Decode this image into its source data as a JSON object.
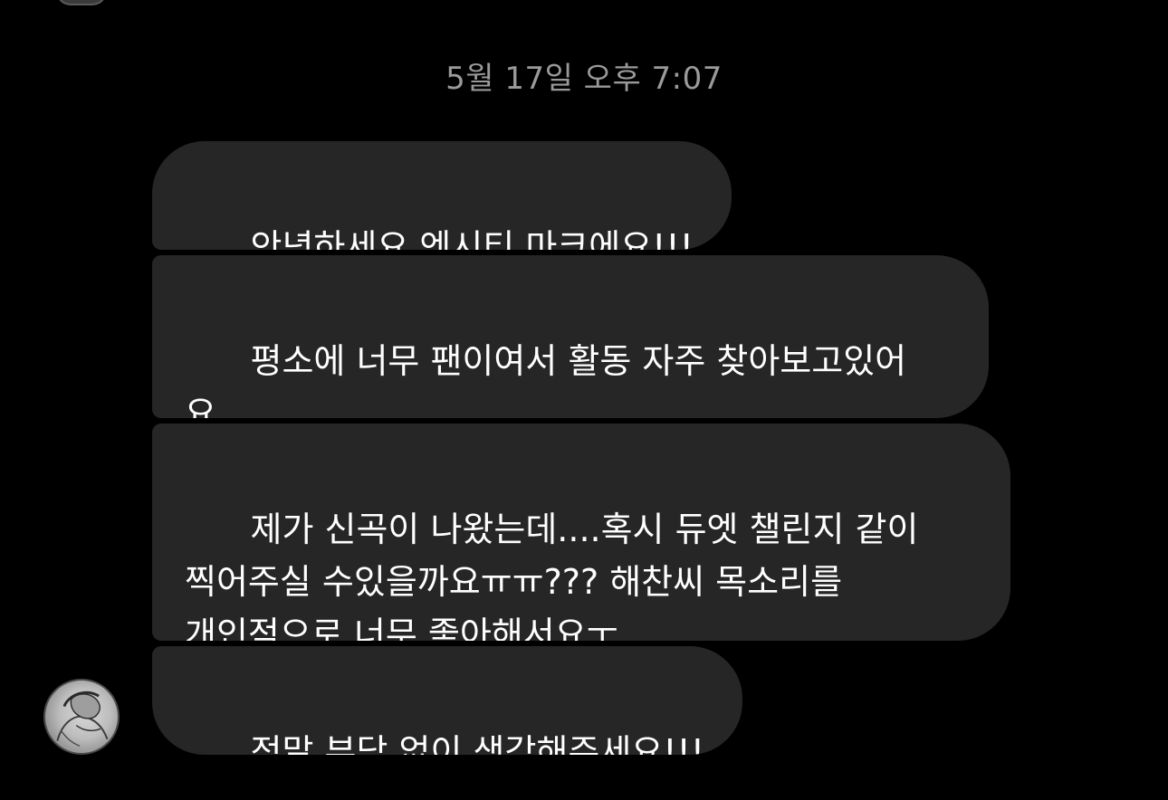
{
  "thread": {
    "timestamp": "5월 17일 오후 7:07",
    "messages": [
      {
        "text": "안녕하세요 엔시티 마크에요!!!"
      },
      {
        "text": "평소에 너무 팬이여서 활동 자주 찾아보고있어\n요"
      },
      {
        "text": "제가 신곡이 나왔는데....혹시 듀엣 챌린지 같이\n찍어주실 수있을까요ㅠㅠ??? 해찬씨 목소리를\n개인적으로 너무 좋아해서요ㅜ"
      },
      {
        "text": "정말 부담 없이 생각해주세요!!!"
      }
    ]
  },
  "colors": {
    "background": "#000000",
    "bubble": "#262626",
    "message_text": "#ffffff",
    "timestamp_text": "#9a9a9a"
  },
  "icons": {
    "sender_avatar": "profile-photo-avatar",
    "top_avatar": "profile-photo-avatar-partial"
  }
}
